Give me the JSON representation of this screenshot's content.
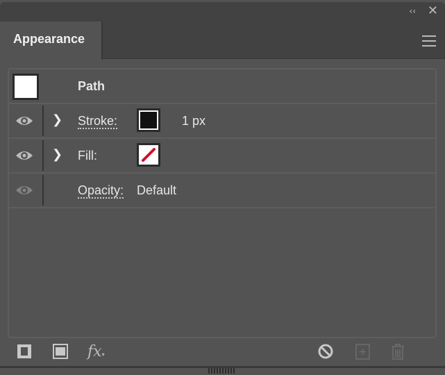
{
  "window": {
    "collapse_icon": "double-chevron-left-icon",
    "close_icon": "close-icon"
  },
  "tab": {
    "label": "Appearance",
    "menu_icon": "hamburger-menu-icon"
  },
  "header": {
    "title": "Path"
  },
  "rows": [
    {
      "label": "Stroke:",
      "value": "1 px",
      "visible": true
    },
    {
      "label": "Fill:",
      "value": "None",
      "visible": true
    },
    {
      "label": "Opacity:",
      "value": "Default",
      "visible": false
    }
  ],
  "colors": {
    "fill_none_slash": "#d0102c",
    "stroke_color": "#111111"
  },
  "toolbar": [
    "add-new-stroke",
    "add-new-fill",
    "add-new-effect",
    "clear-appearance",
    "duplicate-item",
    "delete-item"
  ]
}
